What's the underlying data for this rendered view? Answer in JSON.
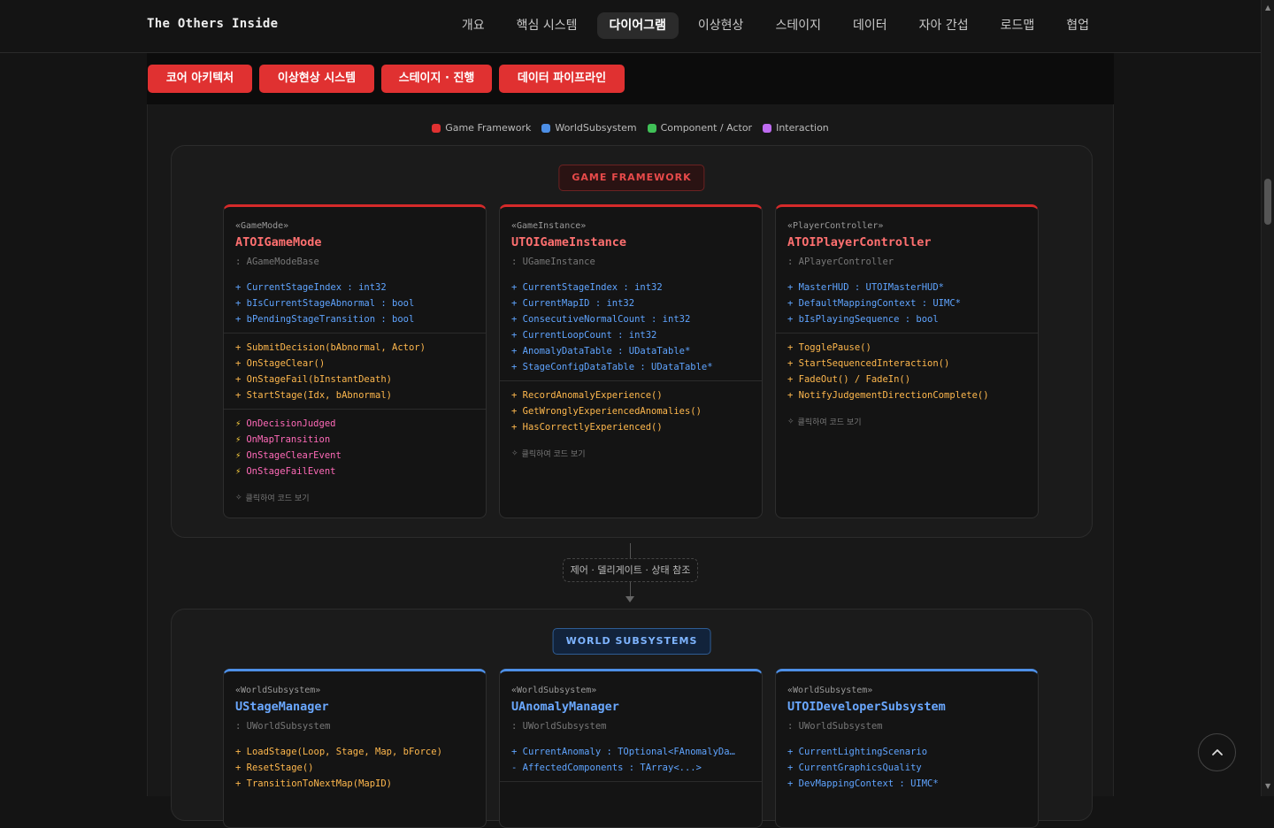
{
  "brand": "The Others Inside",
  "nav": [
    "개요",
    "핵심 시스템",
    "다이어그램",
    "이상현상",
    "스테이지",
    "데이터",
    "자아 간섭",
    "로드맵",
    "협업"
  ],
  "nav_active": "다이어그램",
  "subtabs": [
    "코어 아키텍처",
    "이상현상 시스템",
    "스테이지 · 진행",
    "데이터 파이프라인"
  ],
  "legend": [
    {
      "label": "Game Framework",
      "color": "#e03131"
    },
    {
      "label": "WorldSubsystem",
      "color": "#4d8fe6"
    },
    {
      "label": "Component / Actor",
      "color": "#40c057"
    },
    {
      "label": "Interaction",
      "color": "#be6bf0"
    }
  ],
  "sections": {
    "framework": {
      "title": "GAME FRAMEWORK",
      "cards": [
        {
          "stereotype": "«GameMode»",
          "name": "ATOIGameMode",
          "parent": ": AGameModeBase",
          "props": [
            "+ CurrentStageIndex : int32",
            "+ bIsCurrentStageAbnormal : bool",
            "+ bPendingStageTransition : bool"
          ],
          "methods": [
            "+ SubmitDecision(bAbnormal, Actor)",
            "+ OnStageClear()",
            "+ OnStageFail(bInstantDeath)",
            "+ StartStage(Idx, bAbnormal)"
          ],
          "events": [
            "OnDecisionJudged",
            "OnMapTransition",
            "OnStageClearEvent",
            "OnStageFailEvent"
          ],
          "hint": "클릭하여 코드 보기"
        },
        {
          "stereotype": "«GameInstance»",
          "name": "UTOIGameInstance",
          "parent": ": UGameInstance",
          "props": [
            "+ CurrentStageIndex : int32",
            "+ CurrentMapID : int32",
            "+ ConsecutiveNormalCount : int32",
            "+ CurrentLoopCount : int32",
            "+ AnomalyDataTable : UDataTable*",
            "+ StageConfigDataTable : UDataTable*"
          ],
          "methods": [
            "+ RecordAnomalyExperience()",
            "+ GetWronglyExperiencedAnomalies()",
            "+ HasCorrectlyExperienced()"
          ],
          "events": [],
          "hint": "클릭하여 코드 보기"
        },
        {
          "stereotype": "«PlayerController»",
          "name": "ATOIPlayerController",
          "parent": ": APlayerController",
          "props": [
            "+ MasterHUD : UTOIMasterHUD*",
            "+ DefaultMappingContext : UIMC*",
            "+ bIsPlayingSequence : bool"
          ],
          "methods": [
            "+ TogglePause()",
            "+ StartSequencedInteraction()",
            "+ FadeOut() / FadeIn()",
            "+ NotifyJudgementDirectionComplete()"
          ],
          "events": [],
          "hint": "클릭하여 코드 보기"
        }
      ]
    },
    "connector": "제어 · 델리게이트 · 상태 참조",
    "world": {
      "title": "WORLD SUBSYSTEMS",
      "cards": [
        {
          "stereotype": "«WorldSubsystem»",
          "name": "UStageManager",
          "parent": ": UWorldSubsystem",
          "props": [],
          "methods": [
            "+ LoadStage(Loop, Stage, Map, bForce)",
            "+ ResetStage()",
            "+ TransitionToNextMap(MapID)"
          ]
        },
        {
          "stereotype": "«WorldSubsystem»",
          "name": "UAnomalyManager",
          "parent": ": UWorldSubsystem",
          "props": [
            "+ CurrentAnomaly : TOptional<FAnomalyDa…",
            "- AffectedComponents : TArray<...>"
          ],
          "methods": []
        },
        {
          "stereotype": "«WorldSubsystem»",
          "name": "UTOIDeveloperSubsystem",
          "parent": ": UWorldSubsystem",
          "props": [
            "+ CurrentLightingScenario",
            "+ CurrentGraphicsQuality",
            "+ DevMappingContext : UIMC*"
          ],
          "methods": []
        }
      ]
    }
  }
}
